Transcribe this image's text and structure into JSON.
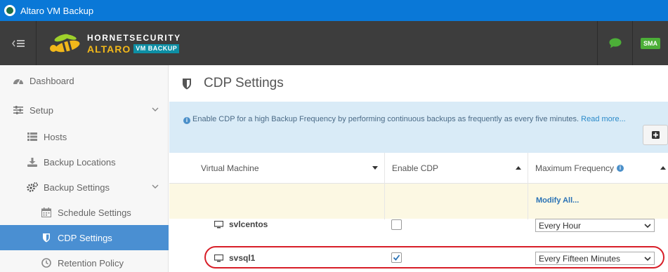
{
  "window": {
    "title": "Altaro VM Backup"
  },
  "header": {
    "brand_top": "HORNETSECURITY",
    "brand_name": "ALTARO",
    "brand_product": "VM BACKUP",
    "sma_label": "SMA"
  },
  "sidebar": {
    "items": [
      {
        "label": "Dashboard",
        "icon": "dashboard-icon"
      },
      {
        "label": "Setup",
        "icon": "sliders-icon"
      },
      {
        "label": "Hosts",
        "icon": "list-icon"
      },
      {
        "label": "Backup Locations",
        "icon": "download-icon"
      },
      {
        "label": "Backup Settings",
        "icon": "gears-icon"
      },
      {
        "label": "Schedule Settings",
        "icon": "calendar-icon"
      },
      {
        "label": "CDP Settings",
        "icon": "shield-icon",
        "active": true
      },
      {
        "label": "Retention Policy",
        "icon": "clock-icon"
      }
    ]
  },
  "main": {
    "title": "CDP Settings",
    "info": {
      "text": "Enable CDP for a high Backup Frequency by performing continuous backups as frequently as every five minutes.",
      "link": "Read more..."
    },
    "columns": [
      "Virtual Machine",
      "Enable CDP",
      "Maximum Frequency"
    ],
    "modify_all": "Modify All...",
    "rows": [
      {
        "name": "svlcentos",
        "cdp_enabled": false,
        "frequency": "Every Hour"
      },
      {
        "name": "svsql1",
        "cdp_enabled": true,
        "frequency": "Every Fifteen Minutes"
      }
    ]
  },
  "colors": {
    "titlebar": "#0a78d7",
    "header": "#3d3d3d",
    "active_nav": "#4a8fd2",
    "info_bg": "#d9ebf7",
    "modify_bg": "#fcf8e3",
    "highlight": "#d81e28",
    "chat_icon": "#4caf38"
  }
}
